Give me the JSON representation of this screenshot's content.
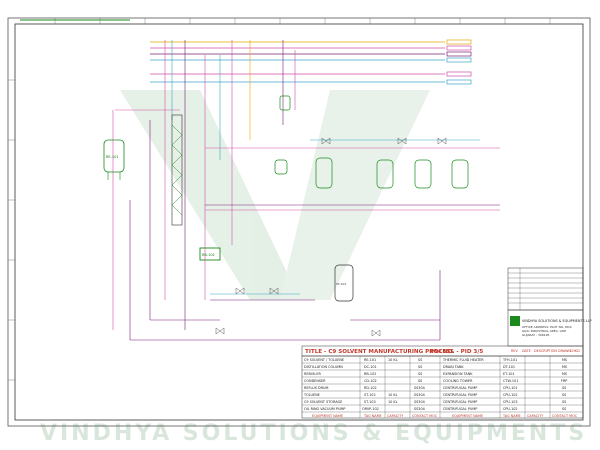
{
  "colors": {
    "border": "#333333",
    "grid_tick": "#666666",
    "equipment": "#1b8a1b",
    "vertical_process": "#d14fa8",
    "steam": "#3aa6c9",
    "cooling": "#e6a800",
    "main_line": "#7a1f7a",
    "title_red": "#c0392b",
    "watermark": "#b9d3bf"
  },
  "equipment_tags": [
    {
      "id": "vessel-left",
      "label": "RE-101"
    },
    {
      "id": "pump-box",
      "label": "RB-102"
    },
    {
      "id": "tank-bottom",
      "label": "ST-101"
    }
  ],
  "watermark": {
    "text": "VINDHYA SOLUTIONS & EQUIPMENTS"
  },
  "title_block": {
    "title": "TITLE - C9 SOLVENT MANUFACTURING PROCESS",
    "pid_no": "P&I NO. - PID 3/5",
    "company": "VINDHYA SOLUTIONS & EQUIPMENTS LLP",
    "address_lines": [
      "OFFICE ADDRESS: PLOT NO. 80/4",
      "GIDC INDUSTRIAL AREA, VAPI",
      "GUJARAT - 396195"
    ],
    "revision_rows": [
      "",
      "",
      "",
      "",
      "",
      "",
      "",
      ""
    ],
    "rev_headers": [
      "REV",
      "DATE",
      "DESCRIPTION",
      "DRAWN",
      "CHKD"
    ],
    "left_rows": [
      {
        "name": "C9 SOLVENT / TOLUENE",
        "tag": "RE-101",
        "cap": "10 KL",
        "moc": "SS"
      },
      {
        "name": "DISTILLATION COLUMN",
        "tag": "DC-101",
        "cap": "",
        "moc": "SS"
      },
      {
        "name": "REBOILER",
        "tag": "RB-102",
        "cap": "",
        "moc": "SS"
      },
      {
        "name": "CONDENSER",
        "tag": "CD-102",
        "cap": "",
        "moc": "SS"
      },
      {
        "name": "REFLUX DRUM",
        "tag": "RD-102",
        "cap": "",
        "moc": "SS304"
      },
      {
        "name": "TOLUENE",
        "tag": "ST-102",
        "cap": "10 KL",
        "moc": "SS304"
      },
      {
        "name": "C9 SOLVENT STORAGE",
        "tag": "ST-103",
        "cap": "10 KL",
        "moc": "SS304"
      },
      {
        "name": "OIL RING VACUUM PUMP",
        "tag": "ORVP-102",
        "cap": "",
        "moc": "SS304"
      }
    ],
    "right_rows": [
      {
        "name": "THERMIC FLUID HEATER",
        "tag": "TFH-101",
        "moc": "MS"
      },
      {
        "name": "DRAIN TANK",
        "tag": "DT-101",
        "moc": "MS"
      },
      {
        "name": "EXPANSION TANK",
        "tag": "ET-101",
        "moc": "MS"
      },
      {
        "name": "COOLING TOWER",
        "tag": "CTW-101",
        "moc": "FRP"
      },
      {
        "name": "CENTRIFUGAL PUMP",
        "tag": "CPU-101",
        "moc": "SS"
      },
      {
        "name": "CENTRIFUGAL PUMP",
        "tag": "CPU-102",
        "moc": "SS"
      },
      {
        "name": "CENTRIFUGAL PUMP",
        "tag": "CPU-103",
        "moc": "SS"
      },
      {
        "name": "CENTRIFUGAL PUMP",
        "tag": "CPU-102",
        "moc": "SS"
      }
    ],
    "footer_left": [
      "EQUIPMENT NAME",
      "TAG NAME",
      "CAPACITY",
      "CONTACT MOC"
    ],
    "footer_right": [
      "EQUIPMENT NAME",
      "TAG NAME",
      "CAPACITY",
      "CONTACT MOC"
    ]
  }
}
